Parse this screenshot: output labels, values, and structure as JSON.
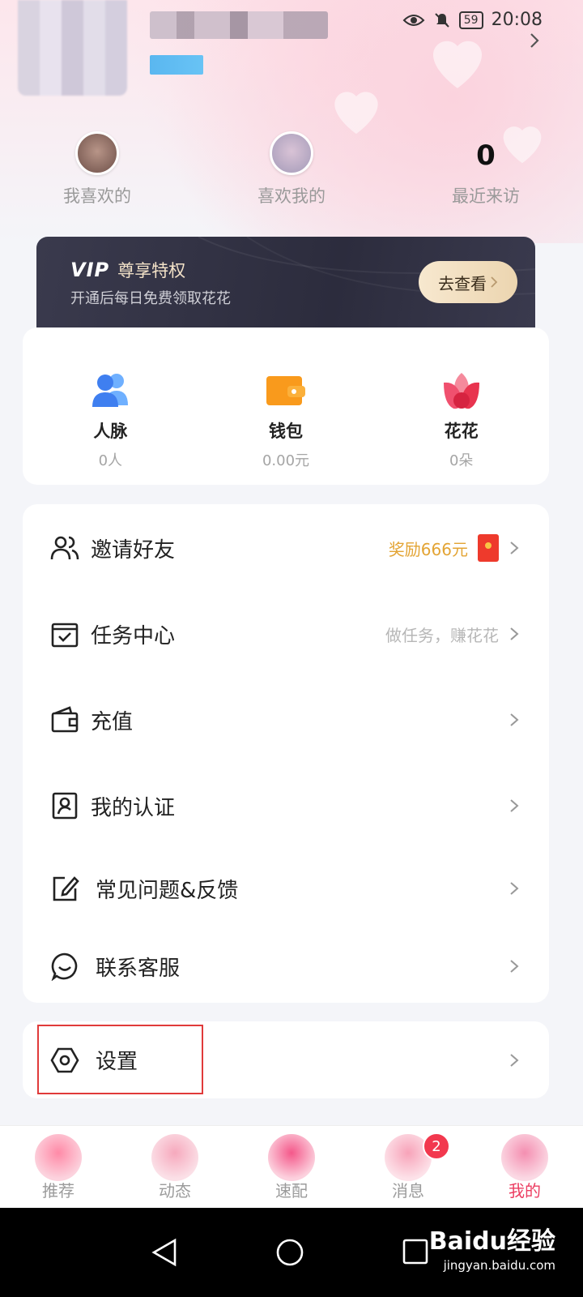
{
  "status_bar": {
    "battery": "59",
    "time": "20:08"
  },
  "stats": [
    {
      "label": "我喜欢的",
      "value": ""
    },
    {
      "label": "喜欢我的",
      "value": ""
    },
    {
      "label": "最近来访",
      "value": "0"
    }
  ],
  "vip": {
    "logo": "VIP",
    "title": "尊享特权",
    "subtitle": "开通后每日免费领取花花",
    "button": "去查看"
  },
  "wallet": [
    {
      "title": "人脉",
      "value": "0人",
      "icon": "people-icon",
      "color": "#4a8ef5"
    },
    {
      "title": "钱包",
      "value": "0.00元",
      "icon": "wallet-icon",
      "color": "#f7931e"
    },
    {
      "title": "花花",
      "value": "0朵",
      "icon": "flower-icon",
      "color": "#f0506e"
    }
  ],
  "menu": [
    {
      "label": "邀请好友",
      "hint": "奖励666元",
      "icon": "invite-friends-icon"
    },
    {
      "label": "任务中心",
      "hint": "做任务，赚花花",
      "icon": "task-center-icon"
    },
    {
      "label": "充值",
      "hint": "",
      "icon": "recharge-wallet-icon"
    },
    {
      "label": "我的认证",
      "hint": "",
      "icon": "verification-icon"
    },
    {
      "label": "常见问题&反馈",
      "hint": "",
      "icon": "edit-feedback-icon"
    },
    {
      "label": "联系客服",
      "hint": "",
      "icon": "customer-service-icon"
    }
  ],
  "settings": {
    "label": "设置",
    "icon": "settings-hexagon-icon"
  },
  "tabs": [
    {
      "label": "推荐",
      "active": false
    },
    {
      "label": "动态",
      "active": false
    },
    {
      "label": "速配",
      "active": false
    },
    {
      "label": "消息",
      "active": false,
      "badge": "2"
    },
    {
      "label": "我的",
      "active": true
    }
  ],
  "watermark": {
    "main": "Baidu经验",
    "sub": "jingyan.baidu.com"
  },
  "colors": {
    "accent": "#ec3e62",
    "gold": "#e3a434",
    "highlight": "#e03a3a"
  }
}
